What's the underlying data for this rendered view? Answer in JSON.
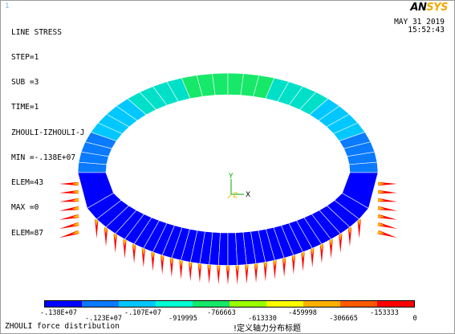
{
  "window": {
    "number": "1"
  },
  "logo": {
    "part1": "AN",
    "part2": "SYS"
  },
  "info": {
    "lines": [
      "LINE STRESS",
      "STEP=1",
      "SUB =3",
      "TIME=1",
      "ZHOULI-IZHOULI-J",
      "MIN =-.138E+07",
      "ELEM=43",
      "MAX =0",
      "ELEM=87"
    ]
  },
  "date": {
    "date": "MAY 31 2019",
    "time": "15:52:43"
  },
  "axes": {
    "x_label": "X",
    "y_label": "Y",
    "z_label": "Z"
  },
  "legend": {
    "colors": [
      "#0000ff",
      "#0a7aff",
      "#00c8ff",
      "#00ffd2",
      "#17e86a",
      "#9aff00",
      "#ffff00",
      "#ffb000",
      "#ff5a00",
      "#ff0000"
    ],
    "bottom_ticks": [
      "-.138E+07",
      "-.107E+07",
      "-766663",
      "-459998",
      "-153333"
    ],
    "top_ticks": [
      "-.123E+07",
      "-919995",
      "-613330",
      "-306665",
      "0"
    ]
  },
  "element_colors": {
    "bottom_beam": "#0000ff",
    "side_wall": "#0000ff",
    "lower_arch": "#0a7aff",
    "mid_arch": "#00c8ff",
    "upper_arch": "#00e0c8",
    "crown": "#17e86a",
    "outline": "#ffffff",
    "spike_tip": "#ff0000",
    "spike_mid": "#ffb000"
  },
  "footer": {
    "left": "ZHOULI force distribution",
    "right": "!定义轴力分布标题"
  }
}
